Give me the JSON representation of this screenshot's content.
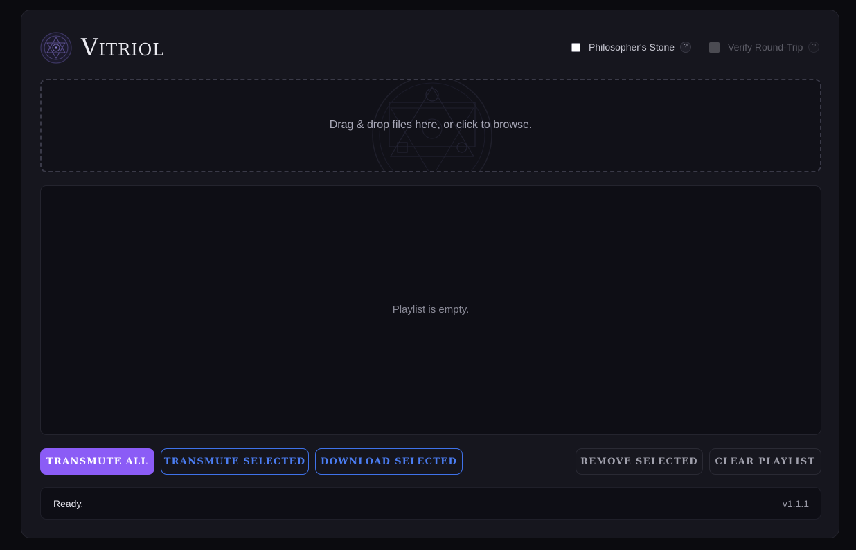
{
  "app": {
    "title": "Vitriol"
  },
  "options": {
    "philosophers_stone": {
      "label": "Philosopher's Stone",
      "checked": false,
      "help": "?"
    },
    "verify_round_trip": {
      "label": "Verify Round-Trip",
      "checked": false,
      "disabled": true,
      "help": "?"
    }
  },
  "dropzone": {
    "text": "Drag & drop files here, or click to browse."
  },
  "playlist": {
    "empty_text": "Playlist is empty."
  },
  "actions": {
    "transmute_all": "TRANSMUTE ALL",
    "transmute_selected": "TRANSMUTE SELECTED",
    "download_selected": "DOWNLOAD SELECTED",
    "remove_selected": "REMOVE SELECTED",
    "clear_playlist": "CLEAR PLAYLIST"
  },
  "status": {
    "text": "Ready.",
    "version": "v1.1.1"
  },
  "colors": {
    "accent": "#8b5cf6",
    "link_blue": "#3f72ea",
    "background": "#0b0b0f",
    "panel": "#16161e"
  }
}
